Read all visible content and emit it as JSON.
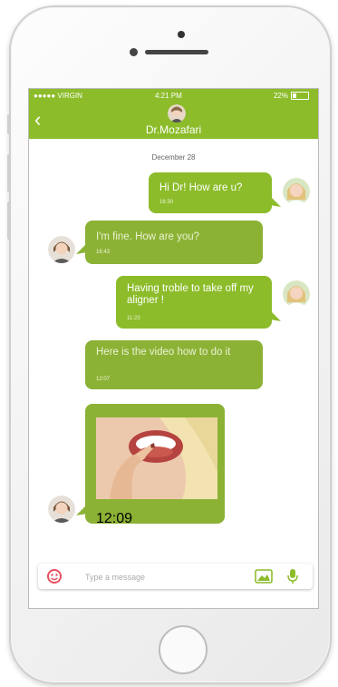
{
  "status_bar": {
    "carrier": "●●●●● VIRGIN",
    "time": "4:21 PM",
    "battery": "22%"
  },
  "header": {
    "back_icon": "chevron-left-icon",
    "contact_name": "Dr.Mozafari"
  },
  "conversation": {
    "date": "December 28",
    "messages": [
      {
        "direction": "out",
        "text": "Hi Dr! How are u?",
        "time": "16:30"
      },
      {
        "direction": "in",
        "text": "I'm fine. How are you?",
        "time": "16:43"
      },
      {
        "direction": "out",
        "text": "Having troble to take off my aligner !",
        "time": "11:23"
      },
      {
        "direction": "in",
        "text": "Here is the video how to do it",
        "time": "12:07"
      },
      {
        "direction": "in",
        "media": "video-thumbnail",
        "time": "12:09"
      }
    ]
  },
  "composer": {
    "placeholder": "Type a message",
    "left_icon": "emoji-icon",
    "image_icon": "image-icon",
    "mic_icon": "microphone-icon"
  },
  "colors": {
    "accent": "#8cbc2a",
    "incoming_bubble": "#8cb235",
    "emoji_icon": "#e94f5e"
  }
}
